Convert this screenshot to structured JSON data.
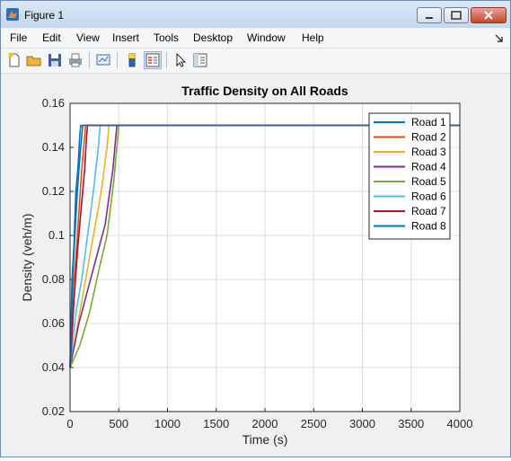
{
  "window": {
    "title": "Figure 1"
  },
  "menu": [
    "File",
    "Edit",
    "View",
    "Insert",
    "Tools",
    "Desktop",
    "Window",
    "Help"
  ],
  "toolbar_icons": [
    "new-figure-icon",
    "open-file-icon",
    "save-icon",
    "print-icon",
    "link-plot-icon",
    "colorbar-icon",
    "legend-icon",
    "edit-plot-arrow-icon",
    "property-inspector-icon"
  ],
  "chart_data": {
    "type": "line",
    "title": "Traffic Density on All Roads",
    "xlabel": "Time (s)",
    "ylabel": "Density (veh/m)",
    "xlim": [
      0,
      4000
    ],
    "ylim": [
      0.02,
      0.16
    ],
    "xticks": [
      0,
      500,
      1000,
      1500,
      2000,
      2500,
      3000,
      3500,
      4000
    ],
    "yticks": [
      0.02,
      0.04,
      0.06,
      0.08,
      0.1,
      0.12,
      0.14,
      0.16
    ],
    "ytick_labels": [
      "0.02",
      "0.04",
      "0.06",
      "0.08",
      "0.1",
      "0.12",
      "0.14",
      "0.16"
    ],
    "grid": true,
    "legend_position": "top-right",
    "series": [
      {
        "name": "Road 1",
        "color": "#0072bd",
        "x": [
          0,
          20,
          40,
          60,
          80,
          100,
          110,
          4000
        ],
        "y": [
          0.04,
          0.08,
          0.095,
          0.12,
          0.13,
          0.145,
          0.15,
          0.15
        ]
      },
      {
        "name": "Road 2",
        "color": "#d95319",
        "x": [
          0,
          30,
          60,
          90,
          120,
          150,
          160,
          4000
        ],
        "y": [
          0.04,
          0.075,
          0.09,
          0.11,
          0.13,
          0.145,
          0.15,
          0.15
        ]
      },
      {
        "name": "Road 3",
        "color": "#edb120",
        "x": [
          0,
          80,
          160,
          240,
          320,
          380,
          400,
          4000
        ],
        "y": [
          0.04,
          0.06,
          0.08,
          0.1,
          0.12,
          0.14,
          0.15,
          0.15
        ]
      },
      {
        "name": "Road 4",
        "color": "#7e2f8e",
        "x": [
          0,
          90,
          180,
          270,
          360,
          440,
          480,
          4000
        ],
        "y": [
          0.04,
          0.06,
          0.075,
          0.09,
          0.105,
          0.13,
          0.15,
          0.15
        ]
      },
      {
        "name": "Road 5",
        "color": "#77ac30",
        "x": [
          0,
          100,
          200,
          300,
          380,
          450,
          500,
          4000
        ],
        "y": [
          0.04,
          0.05,
          0.065,
          0.085,
          0.1,
          0.125,
          0.15,
          0.15
        ]
      },
      {
        "name": "Road 6",
        "color": "#4dbeee",
        "x": [
          0,
          60,
          120,
          180,
          240,
          290,
          310,
          4000
        ],
        "y": [
          0.04,
          0.065,
          0.08,
          0.1,
          0.12,
          0.14,
          0.15,
          0.15
        ]
      },
      {
        "name": "Road 7",
        "color": "#a2142f",
        "x": [
          0,
          40,
          80,
          120,
          150,
          170,
          180,
          4000
        ],
        "y": [
          0.04,
          0.07,
          0.095,
          0.115,
          0.13,
          0.145,
          0.15,
          0.15
        ]
      },
      {
        "name": "Road 8",
        "color": "#0072bd",
        "x": [
          0,
          25,
          50,
          75,
          100,
          120,
          130,
          4000
        ],
        "y": [
          0.04,
          0.08,
          0.1,
          0.12,
          0.135,
          0.145,
          0.15,
          0.15
        ]
      }
    ]
  }
}
